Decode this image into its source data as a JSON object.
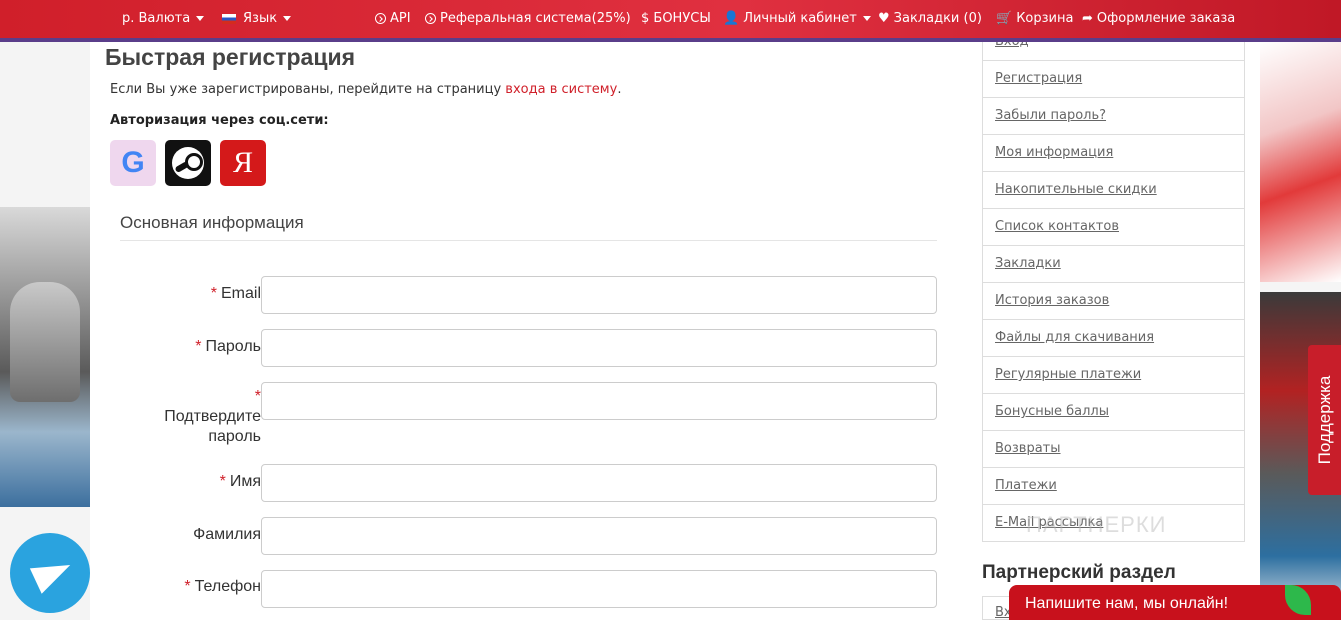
{
  "topbar": {
    "currency_label": "р. Валюта",
    "language_label": "Язык",
    "api_label": "API",
    "referral_label": "Реферальная система(25%)",
    "bonus_label": "$ БОНУСЫ",
    "account_label": "Личный кабинет",
    "bookmarks_label": "Закладки (0)",
    "cart_label": "Корзина",
    "checkout_label": "Оформление заказа"
  },
  "main": {
    "title": "Быстрая регистрация",
    "intro_text": "Если Вы уже зарегистрированы, перейдите на страницу ",
    "intro_link": "входа в систему",
    "intro_end": ".",
    "social_title": "Авторизация через соц.сети:",
    "section_title": "Основная информация",
    "required_mark": "*",
    "fields": {
      "email": "Email",
      "password": "Пароль",
      "confirm_line1": "Подтвердите",
      "confirm_line2": "пароль",
      "first_name": "Имя",
      "last_name": "Фамилия",
      "phone": "Телефон"
    }
  },
  "sidebar": {
    "items": [
      "Вход",
      "Регистрация",
      "Забыли пароль?",
      "Моя информация",
      "Накопительные скидки",
      "Список контактов",
      "Закладки",
      "История заказов",
      "Файлы для скачивания",
      "Регулярные платежи",
      "Бонусные баллы",
      "Возвраты",
      "Платежи",
      "E-Mail рассылка"
    ],
    "partner_title": "Партнерский раздел",
    "partner_first": "Вх"
  },
  "watermark": "ПАРТНЕРКИ",
  "support_label": "Поддержка",
  "chat_label": "Напишите нам, мы онлайн!",
  "colors": {
    "brand_red": "#d01f2a",
    "link_red": "#d0202a",
    "telegram_blue": "#2aa3df"
  }
}
